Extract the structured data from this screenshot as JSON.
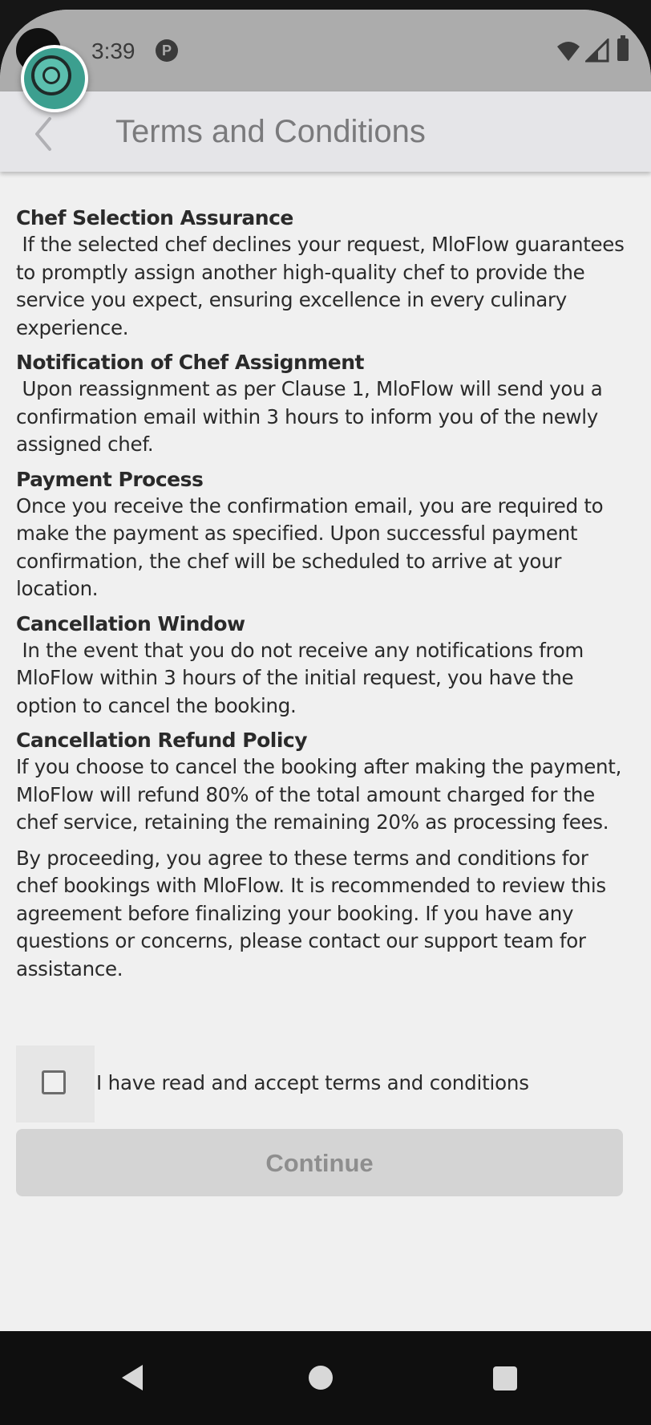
{
  "status_bar": {
    "time": "3:39",
    "notification_icon": "P",
    "icons": [
      "wifi-icon",
      "signal-icon",
      "battery-icon"
    ]
  },
  "header": {
    "title": "Terms and Conditions",
    "back_icon": "chevron-left-icon"
  },
  "sections": [
    {
      "title": "Chef Selection Assurance",
      "body": " If the selected chef declines your request, MloFlow guarantees to promptly assign another high-quality chef to provide the service you expect, ensuring excellence in every culinary experience."
    },
    {
      "title": "Notification of Chef Assignment",
      "body": " Upon reassignment as per Clause 1, MloFlow will send you a confirmation email within 3 hours to inform you of the newly assigned chef."
    },
    {
      "title": "Payment Process",
      "body": "Once you receive the confirmation email, you are required to make the payment as specified. Upon successful payment confirmation, the chef will be scheduled to arrive at your location."
    },
    {
      "title": "Cancellation Window",
      "body": " In the event that you do not receive any notifications from MloFlow within 3 hours of the initial request, you have the option to cancel the booking."
    },
    {
      "title": "Cancellation Refund Policy",
      "body": "If you choose to cancel the booking after making the payment, MloFlow will refund 80% of the total amount charged for the chef service, retaining the remaining 20% as processing fees."
    }
  ],
  "closing": "By proceeding, you agree to these terms and conditions for chef bookings with MloFlow. It is recommended to review this agreement before finalizing your booking. If you have any questions or concerns, please contact our support team for assistance.",
  "accept": {
    "label": "I have read and accept terms and conditions",
    "checked": false
  },
  "continue_button": {
    "label": "Continue",
    "enabled": false
  },
  "colors": {
    "status_bar": "#acacac",
    "app_bar": "#e5e5e8",
    "background": "#f0f0f0",
    "button_disabled": "#d4d4d4",
    "overlay_accent": "#3c9f8f"
  }
}
